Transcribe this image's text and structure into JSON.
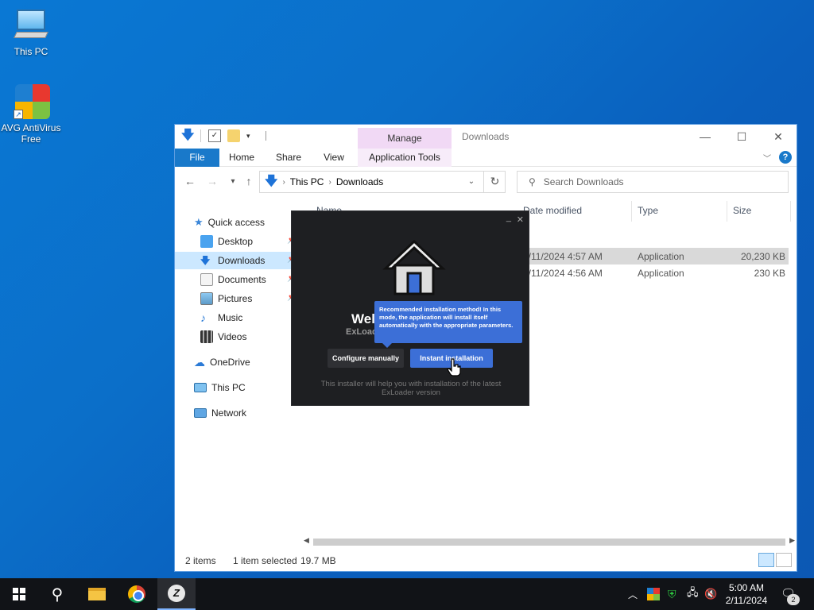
{
  "desktop": {
    "icons": [
      {
        "label": "This PC"
      },
      {
        "label": "AVG AntiVirus Free"
      }
    ]
  },
  "explorer": {
    "title": "Downloads",
    "manage_tab": "Manage",
    "ribbon_tabs": [
      "File",
      "Home",
      "Share",
      "View",
      "Application Tools"
    ],
    "address": {
      "segments": [
        "This PC",
        "Downloads"
      ]
    },
    "search_placeholder": "Search Downloads",
    "sidebar": {
      "quick_access": "Quick access",
      "items": [
        "Desktop",
        "Downloads",
        "Documents",
        "Pictures",
        "Music",
        "Videos"
      ],
      "onedrive": "OneDrive",
      "thispc": "This PC",
      "network": "Network"
    },
    "columns": {
      "name": "Name",
      "date": "Date modified",
      "type": "Type",
      "size": "Size"
    },
    "files": [
      {
        "date": "2/11/2024 4:57 AM",
        "type": "Application",
        "size": "20,230 KB",
        "selected": true
      },
      {
        "date": "2/11/2024 4:56 AM",
        "type": "Application",
        "size": "230 KB",
        "selected": false
      }
    ],
    "status": {
      "items": "2 items",
      "selected": "1 item selected",
      "size": "19.7 MB"
    }
  },
  "installer": {
    "welcome": "Welcome",
    "subtitle": "ExLoader",
    "tooltip": "Recommended installation method! In this mode, the application will install itself automatically with the appropriate parameters.",
    "btn_configure": "Configure manually",
    "btn_instant": "Instant installation",
    "footer": "This installer will help you with installation of the latest ExLoader version"
  },
  "taskbar": {
    "time": "5:00 AM",
    "date": "2/11/2024",
    "notification_count": "2"
  }
}
